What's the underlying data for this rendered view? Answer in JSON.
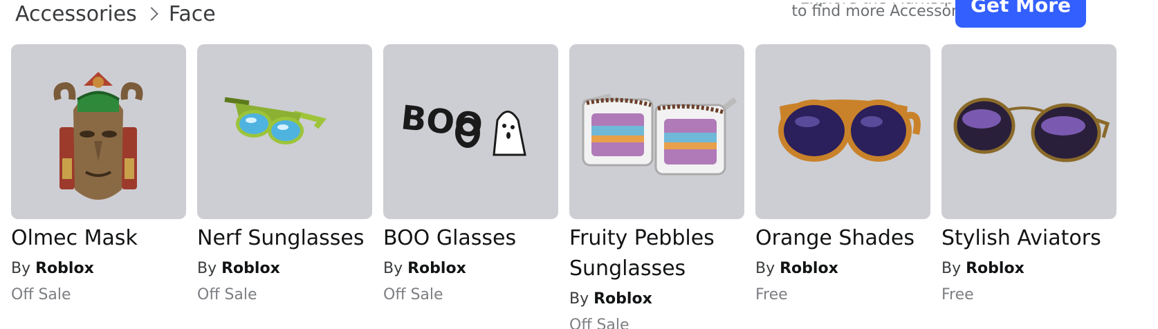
{
  "breadcrumb": {
    "parent": "Accessories",
    "current": "Face"
  },
  "promo": {
    "line1": "Explore the Marketplace",
    "line2": "to find more Accessories!",
    "button_label": "Get More"
  },
  "items": [
    {
      "name": "Olmec Mask",
      "by": "By",
      "creator": "Roblox",
      "price": "Off Sale",
      "icon": "olmec-mask-icon"
    },
    {
      "name": "Nerf Sunglasses",
      "by": "By",
      "creator": "Roblox",
      "price": "Off Sale",
      "icon": "nerf-sunglasses-icon"
    },
    {
      "name": "BOO Glasses",
      "by": "By",
      "creator": "Roblox",
      "price": "Off Sale",
      "icon": "boo-glasses-icon"
    },
    {
      "name": "Fruity Pebbles Sunglasses",
      "by": "By",
      "creator": "Roblox",
      "price": "Off Sale",
      "icon": "fruity-pebbles-sunglasses-icon"
    },
    {
      "name": "Orange Shades",
      "by": "By",
      "creator": "Roblox",
      "price": "Free",
      "icon": "orange-shades-icon"
    },
    {
      "name": "Stylish Aviators",
      "by": "By",
      "creator": "Roblox",
      "price": "Free",
      "icon": "stylish-aviators-icon"
    }
  ],
  "colors": {
    "accent": "#335fff",
    "thumb_bg": "#cdced3",
    "muted_text": "#7c7e82"
  }
}
